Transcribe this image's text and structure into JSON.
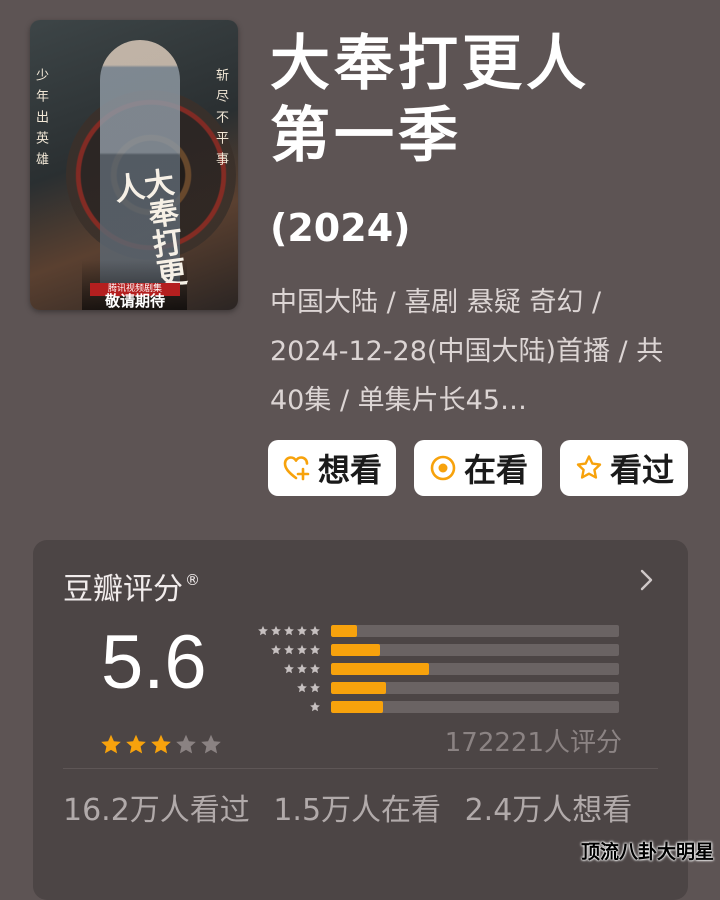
{
  "poster": {
    "left_text": "少年出英雄",
    "right_text": "斩尽不平事",
    "calligraphy": "大奉打更人",
    "platform": "腾讯视频剧集",
    "bottom_text": "敬请期待"
  },
  "title": {
    "line1": "大奉打更人",
    "line2": "第一季",
    "year": "(2024)"
  },
  "meta": "中国大陆 / 喜剧 悬疑 奇幻 / 2024-12-28(中国大陆)首播 / 共40集 / 单集片长45…",
  "actions": [
    {
      "label": "想看",
      "icon": "heart-plus-icon"
    },
    {
      "label": "在看",
      "icon": "target-circle-icon"
    },
    {
      "label": "看过",
      "icon": "star-outline-icon"
    }
  ],
  "rating": {
    "title": "豆瓣评分",
    "registered": "®",
    "score": "5.6",
    "stars_filled": 3,
    "stars_total": 5,
    "distribution": [
      {
        "stars": 5,
        "fraction": 0.09
      },
      {
        "stars": 4,
        "fraction": 0.17
      },
      {
        "stars": 3,
        "fraction": 0.34
      },
      {
        "stars": 2,
        "fraction": 0.19
      },
      {
        "stars": 1,
        "fraction": 0.18
      }
    ],
    "count": "172221人评分",
    "stats": "16.2万人看过 1.5万人在看 2.4万人想看"
  },
  "watermark": "顶流八卦大明星",
  "colors": {
    "background": "#5d5454",
    "card": "#4c4545",
    "accent": "#f7a20c",
    "star_empty": "#8a8282"
  }
}
